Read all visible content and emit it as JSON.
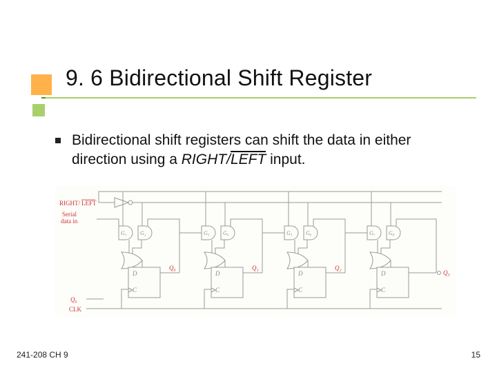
{
  "title": "9. 6 Bidirectional Shift Register",
  "bullet": {
    "prefix": "Bidirectional shift registers can shift the data in either direction using a ",
    "signal_a": "RIGHT/",
    "signal_b": "LEFT",
    "suffix": " input."
  },
  "diagram": {
    "input_signal_a": "RIGHT/",
    "input_signal_b": "LEFT",
    "serial_label_1": "Serial",
    "serial_label_2": "data in",
    "clk": "CLK",
    "q0": "Q₀",
    "gates": [
      "G₁",
      "G₂",
      "G₃",
      "G₄",
      "G₅",
      "G₆",
      "G₇",
      "G₈"
    ],
    "ff_D": "D",
    "ff_C": "C",
    "outputs": [
      "Q₀",
      "Q₁",
      "Q₂",
      "Q₃"
    ]
  },
  "footer": {
    "left": "241-208 CH 9",
    "right": "15"
  }
}
